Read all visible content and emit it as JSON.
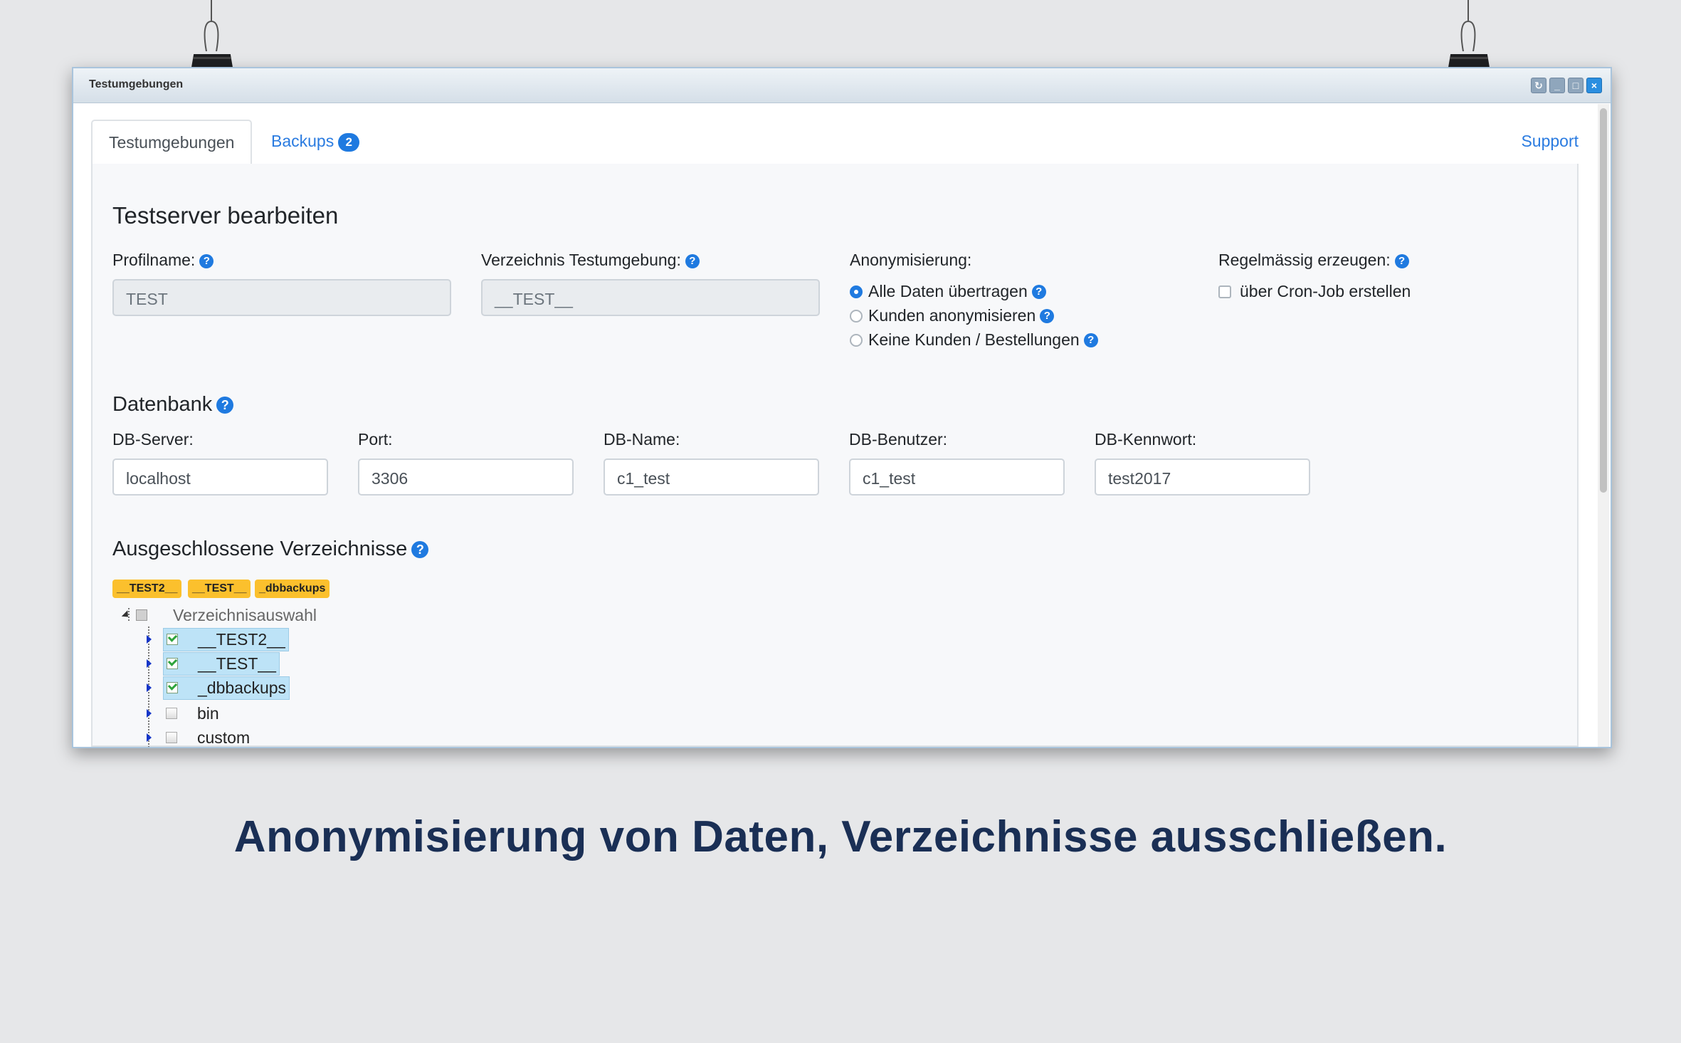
{
  "window": {
    "title": "Testumgebungen"
  },
  "tabs": [
    {
      "label": "Testumgebungen"
    },
    {
      "label": "Backups",
      "badge": "2"
    }
  ],
  "support_link": "Support",
  "form": {
    "title": "Testserver bearbeiten",
    "profile_label": "Profilname:",
    "profile_value": "TEST",
    "dir_label": "Verzeichnis Testumgebung:",
    "dir_value": "__TEST__",
    "anon_label": "Anonymisierung:",
    "anon_options": [
      {
        "label": "Alle Daten übertragen",
        "selected": true
      },
      {
        "label": "Kunden anonymisieren",
        "selected": false
      },
      {
        "label": "Keine Kunden / Bestellungen",
        "selected": false
      }
    ],
    "regular_label": "Regelmässig erzeugen:",
    "cron_label": "über Cron-Job erstellen",
    "cron_checked": false
  },
  "database": {
    "title": "Datenbank",
    "server_label": "DB-Server:",
    "server_value": "localhost",
    "port_label": "Port:",
    "port_value": "3306",
    "name_label": "DB-Name:",
    "name_value": "c1_test",
    "user_label": "DB-Benutzer:",
    "user_value": "c1_test",
    "password_label": "DB-Kennwort:",
    "password_value": "test2017"
  },
  "excluded": {
    "title": "Ausgeschlossene Verzeichnisse",
    "tags": [
      "__TEST2__",
      "__TEST__",
      "_dbbackups"
    ],
    "root_label": "Verzeichnisauswahl",
    "items": [
      {
        "label": "__TEST2__",
        "checked": true
      },
      {
        "label": "__TEST__",
        "checked": true
      },
      {
        "label": "_dbbackups",
        "checked": true
      },
      {
        "label": "bin",
        "checked": false
      },
      {
        "label": "custom",
        "checked": false
      }
    ]
  },
  "caption": "Anonymisierung von Daten, Verzeichnisse ausschließen.",
  "colors": {
    "accent": "#1f7ae0",
    "tag": "#fbc02d",
    "caption": "#1a2f55"
  }
}
